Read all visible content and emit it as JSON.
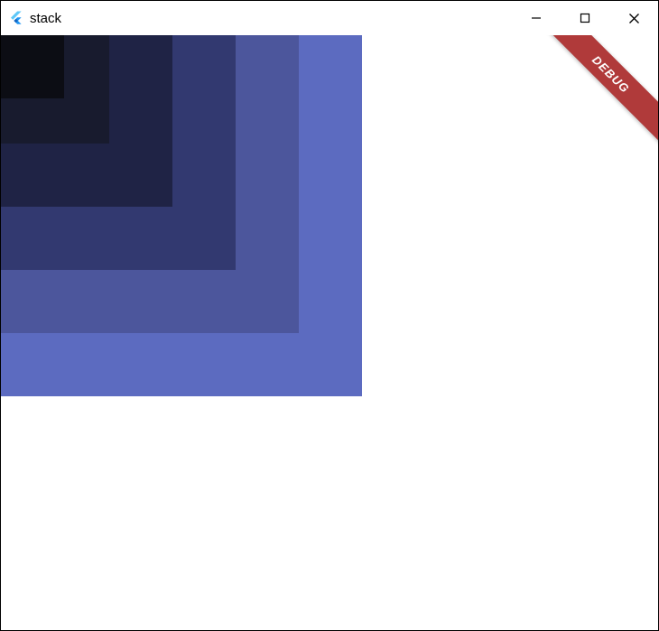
{
  "window": {
    "title": "stack",
    "icon": "flutter-logo-icon"
  },
  "controls": {
    "minimize": "minimize-icon",
    "maximize": "maximize-icon",
    "close": "close-icon"
  },
  "debug": {
    "label": "DEBUG"
  },
  "stack": {
    "squares": [
      {
        "size": 400,
        "color": "#5C6BC0"
      },
      {
        "size": 330,
        "color": "#4C569C"
      },
      {
        "size": 260,
        "color": "#323970"
      },
      {
        "size": 190,
        "color": "#1F2345"
      },
      {
        "size": 120,
        "color": "#181B2E"
      },
      {
        "size": 70,
        "color": "#0C0D14"
      }
    ]
  }
}
